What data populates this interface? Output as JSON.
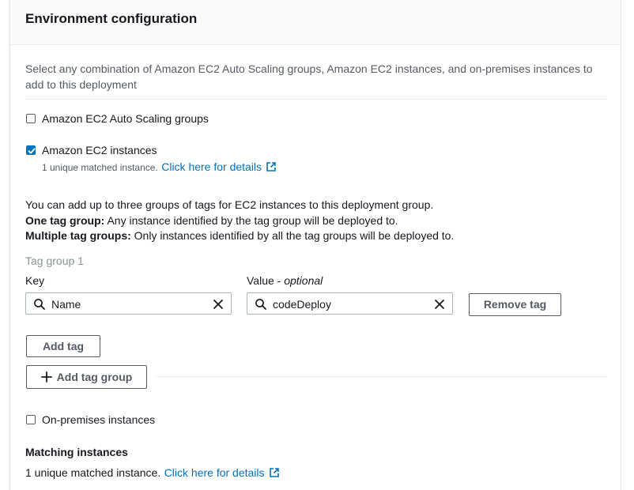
{
  "header": {
    "title": "Environment configuration"
  },
  "description": "Select any combination of Amazon EC2 Auto Scaling groups, Amazon EC2 instances, and on-premises instances to add to this deployment",
  "options": {
    "asg": {
      "label": "Amazon EC2 Auto Scaling groups",
      "checked": false
    },
    "ec2": {
      "label": "Amazon EC2 instances",
      "checked": true,
      "matched_text": "1 unique matched instance.",
      "details_link": "Click here for details"
    },
    "onprem": {
      "label": "On-premises instances",
      "checked": false
    }
  },
  "info": {
    "line1": "You can add up to three groups of tags for EC2 instances to this deployment group.",
    "line2_bold": "One tag group:",
    "line2_rest": " Any instance identified by the tag group will be deployed to.",
    "line3_bold": "Multiple tag groups:",
    "line3_rest": " Only instances identified by all the tag groups will be deployed to."
  },
  "tag_group": {
    "title": "Tag group 1",
    "key_label": "Key",
    "value_label": "Value - ",
    "value_optional": "optional",
    "key_value": "Name",
    "value_value": "codeDeploy",
    "remove_tag": "Remove tag",
    "add_tag": "Add tag",
    "add_tag_group": "Add tag group"
  },
  "matching": {
    "title": "Matching instances",
    "text": "1 unique matched instance.",
    "link": "Click here for details"
  },
  "colors": {
    "link": "#0073bb",
    "checkbox_checked": "#0073bb",
    "text": "#16191f",
    "muted": "#545b64"
  },
  "icons": [
    "checkmark-icon",
    "external-link-icon",
    "search-icon",
    "clear-icon",
    "plus-icon"
  ]
}
